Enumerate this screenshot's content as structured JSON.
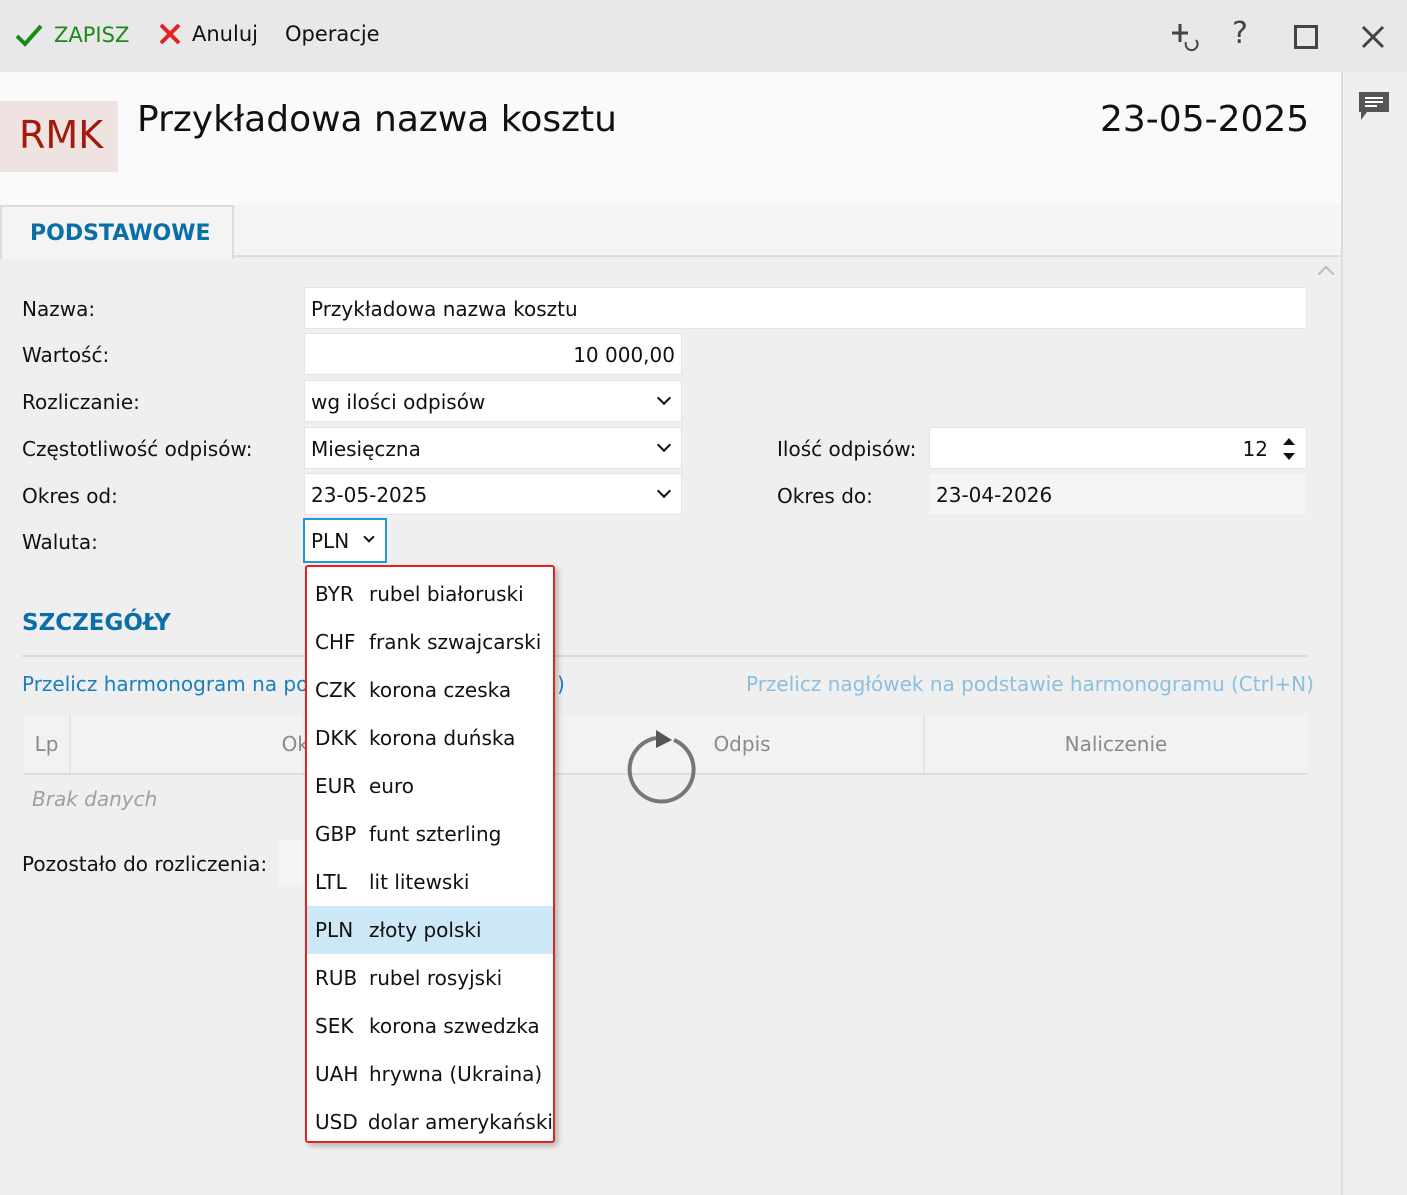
{
  "toolbar": {
    "save": "ZAPISZ",
    "cancel": "Anuluj",
    "operations": "Operacje"
  },
  "header": {
    "badge": "RMK",
    "title": "Przykładowa nazwa kosztu",
    "date": "23-05-2025"
  },
  "tabs": [
    {
      "label": "PODSTAWOWE"
    }
  ],
  "form": {
    "name_label": "Nazwa:",
    "name_value": "Przykładowa nazwa kosztu",
    "value_label": "Wartość:",
    "value_value": "10 000,00",
    "settlement_label": "Rozliczanie:",
    "settlement_value": "wg ilości odpisów",
    "freq_label": "Częstotliwość odpisów:",
    "freq_value": "Miesięczna",
    "count_label": "Ilość odpisów:",
    "count_value": "12",
    "from_label": "Okres od:",
    "from_value": "23-05-2025",
    "to_label": "Okres do:",
    "to_value": "23-04-2026",
    "currency_label": "Waluta:",
    "currency_value": "PLN"
  },
  "currency_options": [
    {
      "code": "BYR",
      "name": "rubel białoruski"
    },
    {
      "code": "CHF",
      "name": "frank szwajcarski"
    },
    {
      "code": "CZK",
      "name": "korona czeska"
    },
    {
      "code": "DKK",
      "name": "korona duńska"
    },
    {
      "code": "EUR",
      "name": "euro"
    },
    {
      "code": "GBP",
      "name": "funt szterling"
    },
    {
      "code": "LTL",
      "name": "lit litewski"
    },
    {
      "code": "PLN",
      "name": "złoty polski",
      "selected": true
    },
    {
      "code": "RUB",
      "name": "rubel rosyjski"
    },
    {
      "code": "SEK",
      "name": "korona szwedzka"
    },
    {
      "code": "UAH",
      "name": "hrywna (Ukraina)"
    },
    {
      "code": "USD",
      "name": "dolar amerykański"
    }
  ],
  "details": {
    "title": "SZCZEGÓŁY",
    "link_left_visible": "Przelicz harmonogram na po",
    "link_left_tail": ")",
    "link_right": "Przelicz nagłówek na podstawie harmonogramu (Ctrl+N)",
    "columns": [
      "Lp",
      "Ok",
      "Odpis",
      "Naliczenie"
    ],
    "empty": "Brak danych",
    "remaining_label": "Pozostało do rozliczenia:"
  },
  "colors": {
    "accent": "#0a6fa8",
    "save": "#1a8a1a",
    "cancel": "#e32222",
    "badge_bg": "#efe3e1",
    "badge_text": "#a11a0a",
    "dropdown_border": "#e32222",
    "selected_option": "#cce8f6"
  }
}
